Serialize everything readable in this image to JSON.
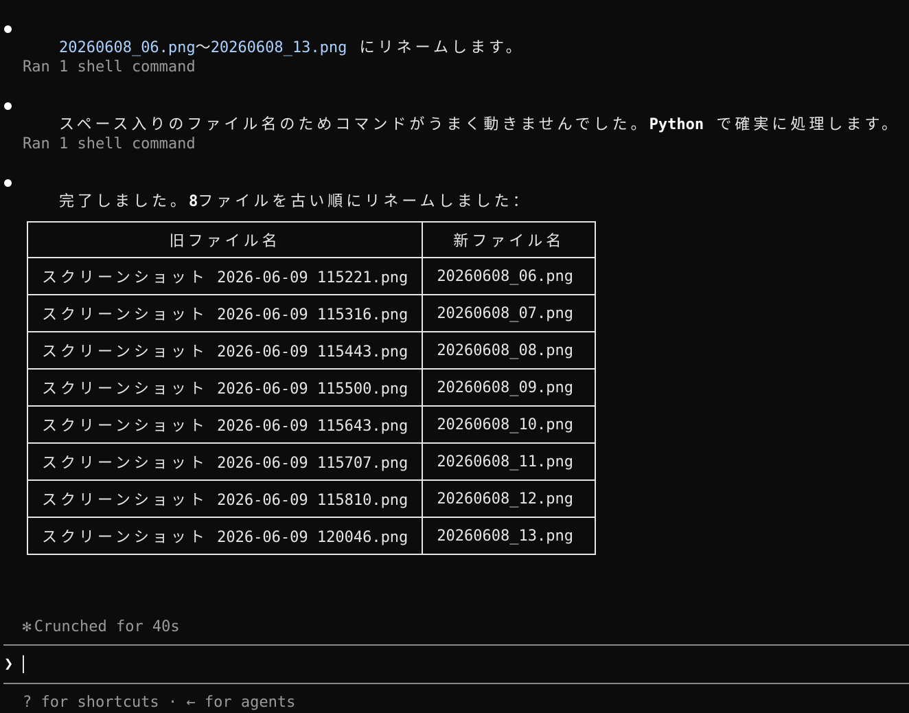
{
  "messages": {
    "m1": {
      "range_start": "20260608_06.png",
      "range_sep": "〜",
      "range_end": "20260608_13.png",
      "suffix": " にリネームします。"
    },
    "tool1": "Ran 1 shell command",
    "m2": {
      "prefix": "スペース入りのファイル名のためコマンドがうまく動きませんでした。",
      "python": "Python",
      "suffix": " で確実に処理します。"
    },
    "tool2": "Ran 1 shell command",
    "m3": {
      "prefix": "完了しました。",
      "count": "8",
      "suffix": "ファイルを古い順にリネームしました："
    }
  },
  "table": {
    "headers": [
      "旧ファイル名",
      "新ファイル名"
    ],
    "rows": [
      {
        "prefix": "スクリーンショット",
        "old": " 2026-06-09 115221.png",
        "new": "20260608_06.png"
      },
      {
        "prefix": "スクリーンショット",
        "old": " 2026-06-09 115316.png",
        "new": "20260608_07.png"
      },
      {
        "prefix": "スクリーンショット",
        "old": " 2026-06-09 115443.png",
        "new": "20260608_08.png"
      },
      {
        "prefix": "スクリーンショット",
        "old": " 2026-06-09 115500.png",
        "new": "20260608_09.png"
      },
      {
        "prefix": "スクリーンショット",
        "old": " 2026-06-09 115643.png",
        "new": "20260608_10.png"
      },
      {
        "prefix": "スクリーンショット",
        "old": " 2026-06-09 115707.png",
        "new": "20260608_11.png"
      },
      {
        "prefix": "スクリーンショット",
        "old": " 2026-06-09 115810.png",
        "new": "20260608_12.png"
      },
      {
        "prefix": "スクリーンショット",
        "old": " 2026-06-09 120046.png",
        "new": "20260608_13.png"
      }
    ]
  },
  "status": {
    "icon": "✻",
    "text": "Crunched for 40s"
  },
  "input": {
    "prompt_symbol": "❯",
    "value": ""
  },
  "footer": {
    "hint": "? for shortcuts · ← for agents"
  },
  "colors": {
    "background": "#0c0c0c",
    "text": "#e6e6e6",
    "filename_blue": "#a9d2ff",
    "dim": "#9a9a9a"
  }
}
